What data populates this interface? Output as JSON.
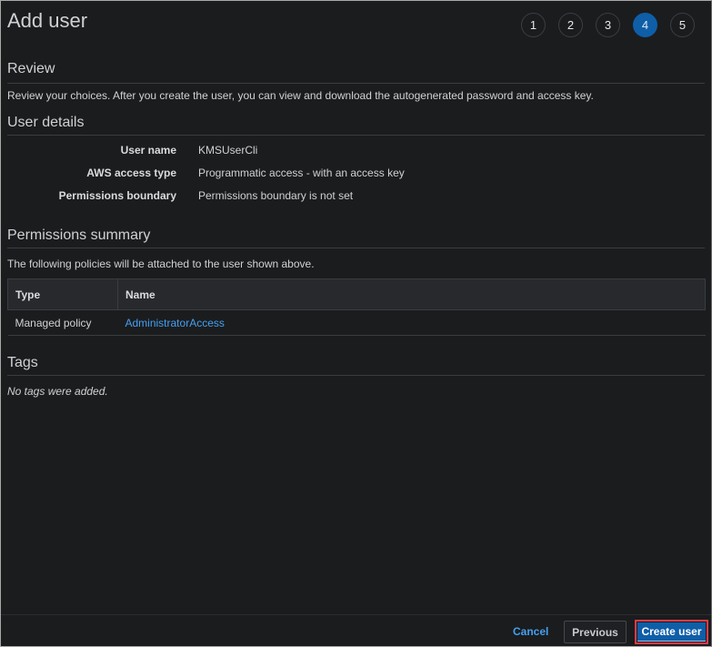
{
  "header": {
    "title": "Add user",
    "steps": [
      {
        "label": "1",
        "active": false
      },
      {
        "label": "2",
        "active": false
      },
      {
        "label": "3",
        "active": false
      },
      {
        "label": "4",
        "active": true
      },
      {
        "label": "5",
        "active": false
      }
    ]
  },
  "review": {
    "title": "Review",
    "description": "Review your choices. After you create the user, you can view and download the autogenerated password and access key."
  },
  "user_details": {
    "title": "User details",
    "rows": [
      {
        "label": "User name",
        "value": "KMSUserCli"
      },
      {
        "label": "AWS access type",
        "value": "Programmatic access - with an access key"
      },
      {
        "label": "Permissions boundary",
        "value": "Permissions boundary is not set"
      }
    ]
  },
  "permissions_summary": {
    "title": "Permissions summary",
    "description": "The following policies will be attached to the user shown above.",
    "columns": [
      "Type",
      "Name"
    ],
    "rows": [
      {
        "type": "Managed policy",
        "name": "AdministratorAccess"
      }
    ]
  },
  "tags": {
    "title": "Tags",
    "empty_text": "No tags were added."
  },
  "footer": {
    "cancel_label": "Cancel",
    "previous_label": "Previous",
    "create_label": "Create user"
  },
  "colors": {
    "accent": "#0f5ea8",
    "link": "#44a0f0",
    "highlight_outline": "#e23b46",
    "background": "#1b1c1e"
  }
}
